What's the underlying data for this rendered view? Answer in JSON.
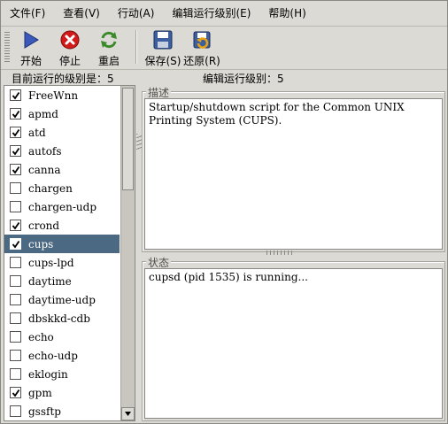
{
  "menubar": {
    "items": [
      "文件(F)",
      "查看(V)",
      "行动(A)",
      "编辑运行级别(E)",
      "帮助(H)"
    ]
  },
  "toolbar": {
    "start_label": "开始",
    "stop_label": "停止",
    "restart_label": "重启",
    "save_label": "保存(S)",
    "revert_label": "还原(R)"
  },
  "info": {
    "current_runlevel": "目前运行的级别是：5",
    "editing_runlevel": "编辑运行级别：5"
  },
  "services": [
    {
      "name": "FreeWnn",
      "checked": true
    },
    {
      "name": "apmd",
      "checked": true
    },
    {
      "name": "atd",
      "checked": true
    },
    {
      "name": "autofs",
      "checked": true
    },
    {
      "name": "canna",
      "checked": true
    },
    {
      "name": "chargen",
      "checked": false
    },
    {
      "name": "chargen-udp",
      "checked": false
    },
    {
      "name": "crond",
      "checked": true
    },
    {
      "name": "cups",
      "checked": true,
      "selected": true
    },
    {
      "name": "cups-lpd",
      "checked": false
    },
    {
      "name": "daytime",
      "checked": false
    },
    {
      "name": "daytime-udp",
      "checked": false
    },
    {
      "name": "dbskkd-cdb",
      "checked": false
    },
    {
      "name": "echo",
      "checked": false
    },
    {
      "name": "echo-udp",
      "checked": false
    },
    {
      "name": "eklogin",
      "checked": false
    },
    {
      "name": "gpm",
      "checked": true
    },
    {
      "name": "gssftp",
      "checked": false
    }
  ],
  "description": {
    "title": "描述",
    "text": "Startup/shutdown script for the Common UNIX Printing System (CUPS)."
  },
  "status": {
    "title": "状态",
    "text": "cupsd (pid 1535) is running..."
  },
  "colors": {
    "selection": "#4b6983",
    "window_bg": "#dcdad5",
    "start_icon": "#3b59b8",
    "stop_icon": "#d11b1b",
    "restart_icon": "#3a8a2a"
  }
}
